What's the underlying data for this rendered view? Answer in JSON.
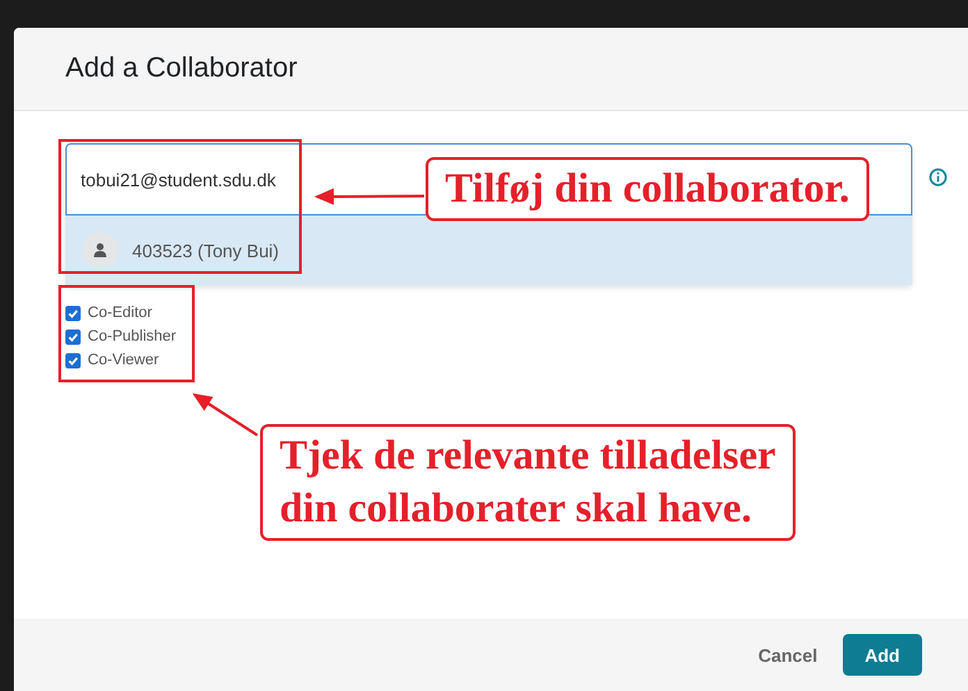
{
  "dialog": {
    "title": "Add a Collaborator"
  },
  "search": {
    "value": "tobui21@student.sdu.dk"
  },
  "suggestions": [
    {
      "label": "403523 (Tony Bui)",
      "selected": true
    }
  ],
  "permissions": [
    {
      "label": "Co-Editor",
      "checked": true
    },
    {
      "label": "Co-Publisher",
      "checked": true
    },
    {
      "label": "Co-Viewer",
      "checked": true
    }
  ],
  "buttons": [
    {
      "label": "Cancel",
      "kind": "link"
    },
    {
      "label": "Add",
      "kind": "primary"
    }
  ],
  "annotations": [
    {
      "lines": [
        "Tilføj din collaborator."
      ]
    },
    {
      "lines": [
        "Tjek de relevante tilladelser",
        "din collaborater skal have."
      ]
    }
  ]
}
